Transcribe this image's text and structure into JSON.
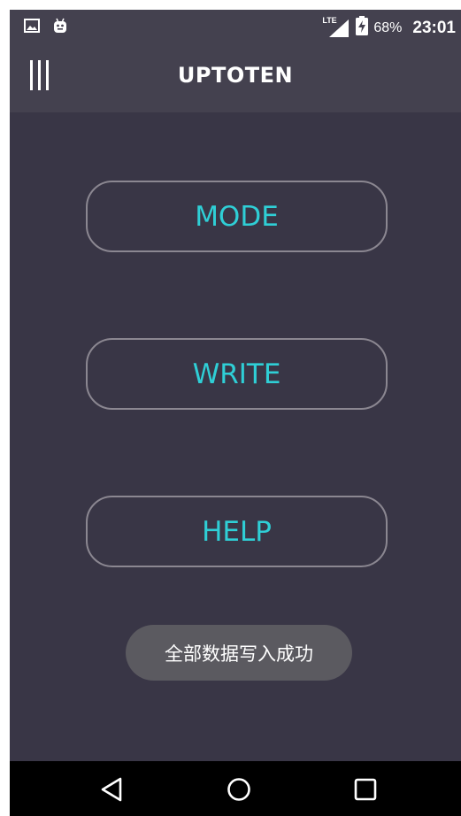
{
  "status_bar": {
    "network": "LTE",
    "battery_percent": "68%",
    "time": "23:01",
    "left_icons": [
      "image-notification-icon",
      "android-notification-icon"
    ],
    "right_icons": [
      "lte-signal-icon",
      "battery-charging-icon"
    ]
  },
  "app_bar": {
    "title": "UPTOTEN",
    "menu_icon": "menu-bars-icon"
  },
  "main": {
    "buttons": [
      {
        "label": "MODE"
      },
      {
        "label": "WRITE"
      },
      {
        "label": "HELP"
      }
    ]
  },
  "toast": {
    "message": "全部数据写入成功"
  },
  "nav_bar": {
    "icons": [
      "back-icon",
      "home-icon",
      "recents-icon"
    ]
  },
  "colors": {
    "background": "#393646",
    "app_bar": "#44414f",
    "button_text": "#2fcfd6",
    "button_border": "#8b8791",
    "toast_bg": "#5b5a60",
    "nav_bar": "#000000"
  }
}
